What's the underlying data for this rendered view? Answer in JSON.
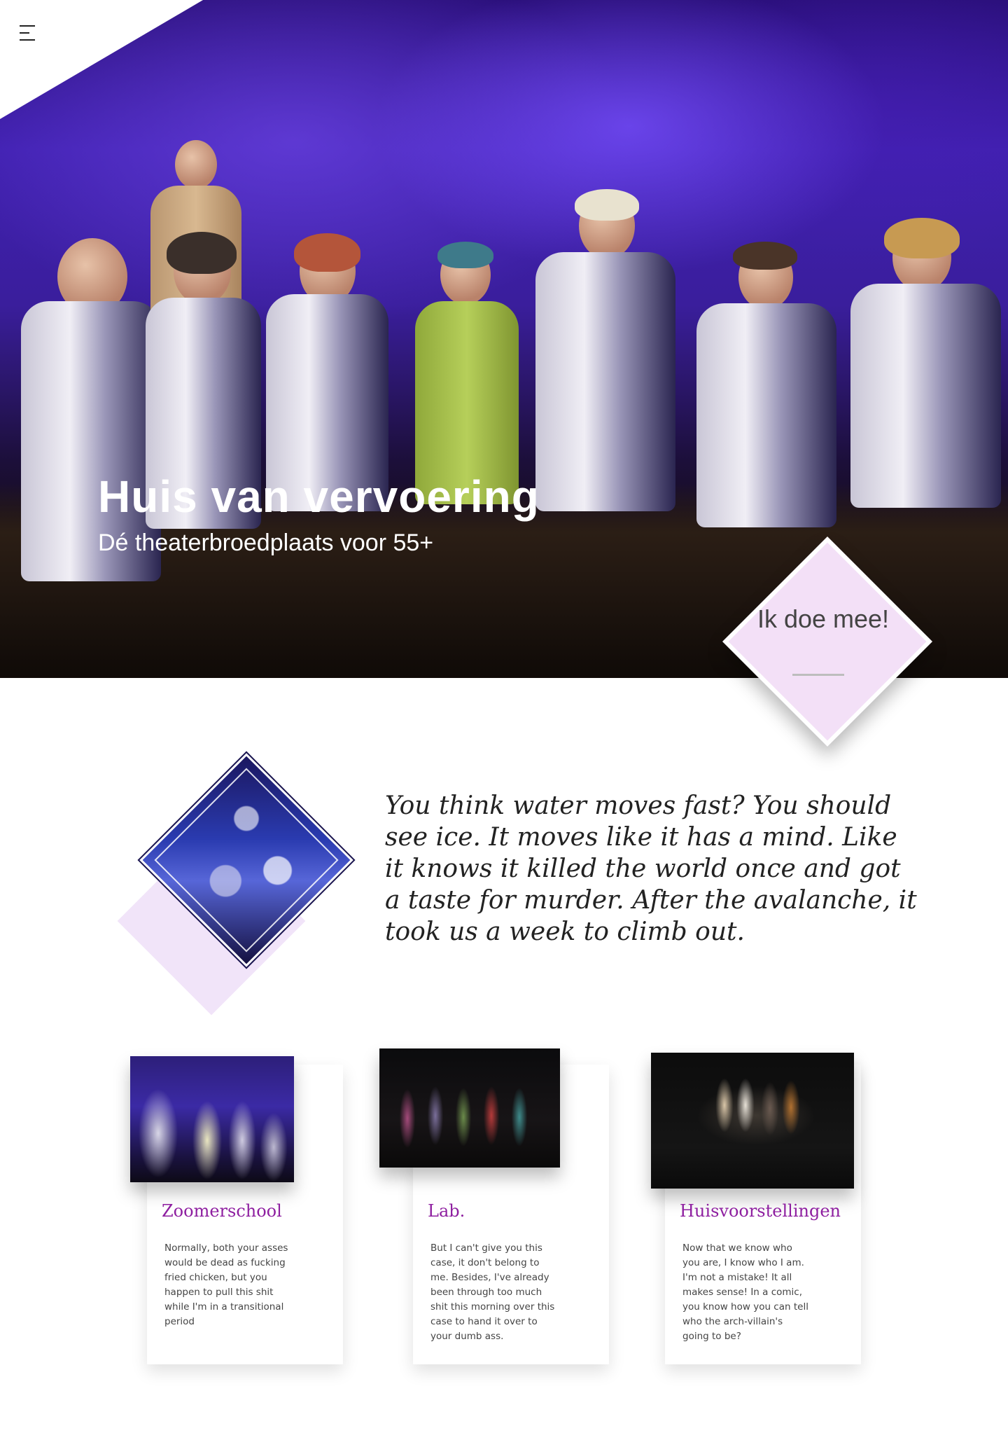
{
  "hero": {
    "title": "Huis van vervoering",
    "subtitle": "Dé theaterbroedplaats voor 55+"
  },
  "nav": {
    "menu_icon": "hamburger-menu-icon"
  },
  "cta": {
    "label": "Ik doe mee!"
  },
  "intro": {
    "quote": "You think water moves fast? You should see ice. It moves like it has a mind. Like it knows it killed the world once and got a taste for murder. After the avalanche, it took us a week to climb out."
  },
  "cards": [
    {
      "title": "Zoomerschool",
      "text": "Normally, both your asses would be dead as fucking fried chicken, but you happen to pull this shit while I'm in a transitional period"
    },
    {
      "title": "Lab.",
      "text": "But I can't give you this case, it don't belong to me. Besides, I've already been through too much shit this morning over this case to hand it over to your dumb ass."
    },
    {
      "title": "Huisvoorstellingen",
      "text": "Now that we know who you are, I know who I am. I'm not a mistake! It all makes sense! In a comic, you know how you can tell who the arch-villain's going to be?"
    }
  ],
  "colors": {
    "accent": "#8e1fa0",
    "cta_background": "#f3e0f7",
    "hero_purple": "#3b1fa0"
  }
}
